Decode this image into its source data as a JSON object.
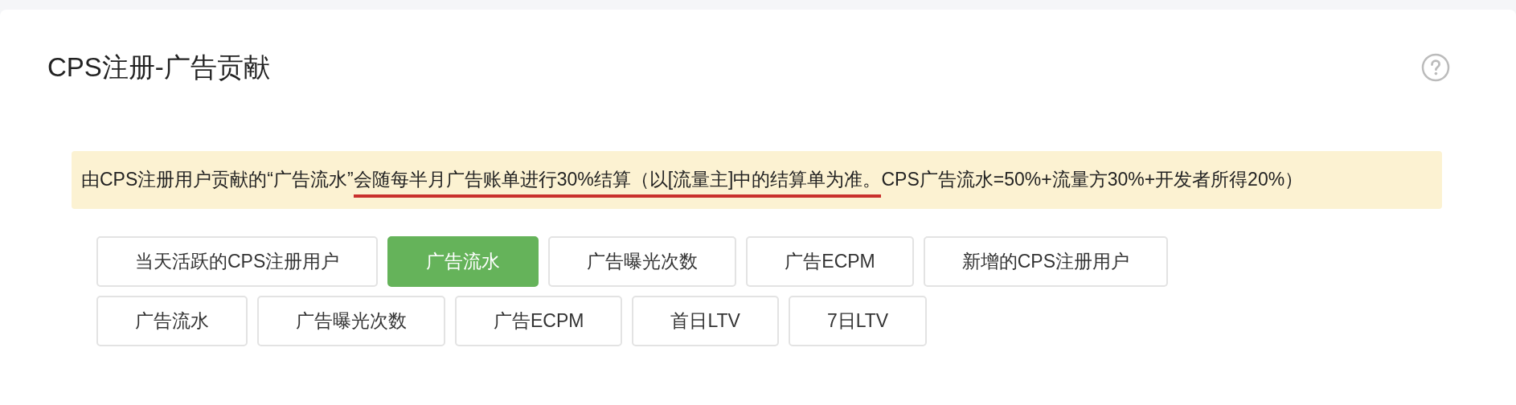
{
  "title": "CPS注册-广告贡献",
  "notice": {
    "text_before": "由CPS注册用户贡献的“广告流水”",
    "underlined": "会随每半月广告账单进行30%结算（以[流量主]中的结算单为准。",
    "text_after": "CPS广告流水=50%+流量方30%+开发者所得20%）"
  },
  "metric_rows": [
    [
      {
        "label": "当天活跃的CPS注册用户",
        "selected": false
      },
      {
        "label": "广告流水",
        "selected": true
      },
      {
        "label": "广告曝光次数",
        "selected": false
      },
      {
        "label": "广告ECPM",
        "selected": false
      },
      {
        "label": "新增的CPS注册用户",
        "selected": false
      }
    ],
    [
      {
        "label": "广告流水",
        "selected": false
      },
      {
        "label": "广告曝光次数",
        "selected": false
      },
      {
        "label": "广告ECPM",
        "selected": false
      },
      {
        "label": "首日LTV",
        "selected": false
      },
      {
        "label": "7日LTV",
        "selected": false
      }
    ]
  ]
}
